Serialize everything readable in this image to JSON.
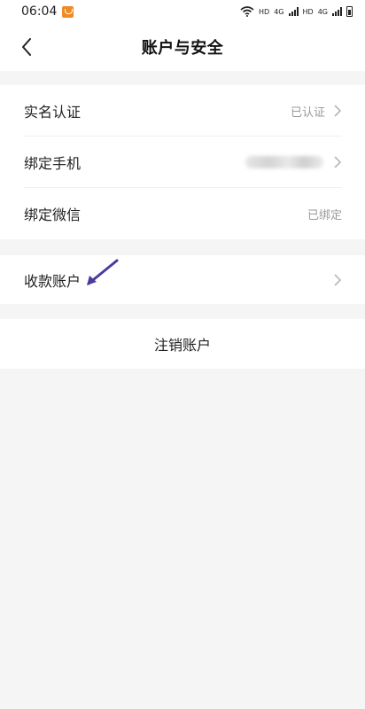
{
  "status_bar": {
    "time": "06:04",
    "hd1": "HD",
    "net1": "4G",
    "hd2": "HD",
    "net2": "4G"
  },
  "header": {
    "title": "账户与安全",
    "back_icon": "chevron-left-icon"
  },
  "settings": {
    "real_name": {
      "label": "实名认证",
      "value": "已认证"
    },
    "bind_phone": {
      "label": "绑定手机",
      "value_hidden": true
    },
    "bind_wechat": {
      "label": "绑定微信",
      "value": "已绑定"
    },
    "payment_account": {
      "label": "收款账户"
    },
    "cancel_account": {
      "label": "注销账户"
    }
  },
  "colors": {
    "background": "#f5f5f5",
    "card": "#ffffff",
    "muted_text": "#9a9a9a",
    "annotation_arrow": "#4b3b9e",
    "notif_badge": "#f08a24"
  }
}
